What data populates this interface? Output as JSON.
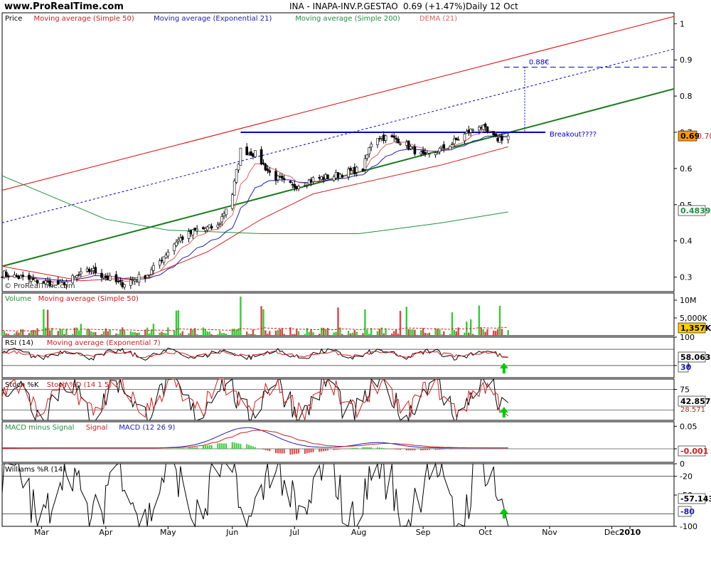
{
  "header": {
    "site": "www.ProRealTime.com",
    "instrument": "INA - INAPA-INV.P.GESTAO",
    "quote": "0.69 (+1.47%)",
    "period": "Daily",
    "date": "12 Oct"
  },
  "watermark": "© ProRealTime.com",
  "colors": {
    "sma50": "#d02020",
    "ema21": "#2020b0",
    "sma200": "#209040",
    "dema": "#e06060",
    "up": "#ffffff",
    "down": "#000000",
    "trend_green": "#1a7a1a",
    "channel_red": "#dd0000",
    "resistance": "#0000cc",
    "volume_up": "#33cc33",
    "volume_down": "#dd4444",
    "signal": "#00cc00"
  },
  "x_axis": {
    "months": [
      "Mar",
      "Apr",
      "May",
      "Jun",
      "Jul",
      "Aug",
      "Sep",
      "Oct",
      "Nov",
      "Dec",
      "2010"
    ]
  },
  "panels": {
    "price": {
      "legend": [
        {
          "text": "Price",
          "color": "#000000"
        },
        {
          "text": "Moving average (Simple 50)",
          "color": "#d02020"
        },
        {
          "text": "Moving average (Exponential 21)",
          "color": "#2020b0"
        },
        {
          "text": "Moving average (Simple 200)",
          "color": "#209040"
        },
        {
          "text": "DEMA (21)",
          "color": "#e06060"
        }
      ],
      "ticks": [
        "1",
        "0.9",
        "0.8",
        "0.7",
        "0.6",
        "0.5",
        "0.4",
        "0.3"
      ],
      "current_label": "0.69",
      "dema_label": "0.704",
      "sma200_label": "0.4839",
      "target_label": "0.88€",
      "breakout_label": "Breakout????"
    },
    "volume": {
      "legend": [
        {
          "text": "Volume",
          "color": "#209040"
        },
        {
          "text": "Moving average (Simple 50)",
          "color": "#d02020"
        }
      ],
      "ticks": [
        "10M",
        "5,000K"
      ],
      "current_label": "1,357K"
    },
    "rsi": {
      "legend": [
        {
          "text": "RSI (14)",
          "color": "#000000"
        },
        {
          "text": "Moving average (Exponential 7)",
          "color": "#d02020"
        }
      ],
      "ticks": [
        "100",
        "30"
      ],
      "current_label": "58.063",
      "level_label": "30"
    },
    "stoch": {
      "legend": [
        {
          "text": "Stoch %K",
          "color": "#000000"
        },
        {
          "text": "Stoch %D (14 1 5)",
          "color": "#d02020"
        }
      ],
      "ticks": [
        "75"
      ],
      "current_label": "42.857",
      "d_label": "28.571"
    },
    "macd": {
      "legend": [
        {
          "text": "MACD minus Signal",
          "color": "#209040"
        },
        {
          "text": "Signal",
          "color": "#d02020"
        },
        {
          "text": "MACD (12 26 9)",
          "color": "#2020b0"
        }
      ],
      "ticks": [
        "0.05",
        "0"
      ],
      "current_label": "-0.001"
    },
    "williams": {
      "legend": [
        {
          "text": "Williams %R (14)",
          "color": "#000000"
        }
      ],
      "ticks": [
        "0",
        "-20",
        "-50",
        "-100"
      ],
      "current_label": "-57.143",
      "level_label": "-80"
    }
  },
  "chart_data": {
    "type": "candlestick",
    "title": "INA - INAPA-INV.P.GESTAO 0.69 (+1.47%) Daily 12 Oct",
    "x_range": [
      "2009-02-10",
      "2009-12-31"
    ],
    "price_ylim": [
      0.26,
      1.03
    ],
    "price_anchors": [
      [
        "2009-02-10",
        0.31
      ],
      [
        "2009-02-25",
        0.29
      ],
      [
        "2009-03-10",
        0.28
      ],
      [
        "2009-03-25",
        0.32
      ],
      [
        "2009-04-08",
        0.28
      ],
      [
        "2009-04-22",
        0.31
      ],
      [
        "2009-05-05",
        0.4
      ],
      [
        "2009-05-15",
        0.43
      ],
      [
        "2009-05-25",
        0.44
      ],
      [
        "2009-06-01",
        0.53
      ],
      [
        "2009-06-05",
        0.65
      ],
      [
        "2009-06-12",
        0.64
      ],
      [
        "2009-06-20",
        0.58
      ],
      [
        "2009-06-30",
        0.55
      ],
      [
        "2009-07-10",
        0.57
      ],
      [
        "2009-07-20",
        0.58
      ],
      [
        "2009-08-03",
        0.6
      ],
      [
        "2009-08-08",
        0.69
      ],
      [
        "2009-08-20",
        0.68
      ],
      [
        "2009-09-02",
        0.63
      ],
      [
        "2009-09-15",
        0.67
      ],
      [
        "2009-09-28",
        0.72
      ],
      [
        "2009-10-06",
        0.68
      ],
      [
        "2009-10-12",
        0.69
      ]
    ],
    "sma200": [
      [
        "2009-02-10",
        0.58
      ],
      [
        "2009-04-01",
        0.46
      ],
      [
        "2009-05-01",
        0.43
      ],
      [
        "2009-06-15",
        0.42
      ],
      [
        "2009-08-01",
        0.42
      ],
      [
        "2009-09-10",
        0.45
      ],
      [
        "2009-10-12",
        0.48
      ]
    ],
    "sma50": [
      [
        "2009-02-10",
        0.33
      ],
      [
        "2009-03-20",
        0.29
      ],
      [
        "2009-04-20",
        0.3
      ],
      [
        "2009-05-20",
        0.37
      ],
      [
        "2009-06-15",
        0.46
      ],
      [
        "2009-07-10",
        0.53
      ],
      [
        "2009-08-10",
        0.57
      ],
      [
        "2009-09-10",
        0.61
      ],
      [
        "2009-10-12",
        0.66
      ]
    ],
    "lines": {
      "support": [
        [
          "2009-02-10",
          0.33
        ],
        [
          "2009-12-31",
          0.82
        ]
      ],
      "channel_top": [
        [
          "2009-02-10",
          0.54
        ],
        [
          "2009-12-31",
          1.02
        ]
      ],
      "channel_dotted": [
        [
          "2009-02-10",
          0.45
        ],
        [
          "2009-12-31",
          0.93
        ]
      ],
      "resistance": {
        "from": "2009-06-05",
        "to": "2009-10-30",
        "value": 0.7
      },
      "target": {
        "from": "2009-10-10",
        "to": "2009-12-31",
        "value": 0.88
      }
    },
    "volume_ylim": [
      0,
      12000000
    ],
    "rsi_ylim": [
      0,
      100
    ],
    "stoch_ylim": [
      0,
      100
    ],
    "macd_ylim": [
      -0.03,
      0.06
    ],
    "williams_ylim": [
      -100,
      0
    ]
  }
}
